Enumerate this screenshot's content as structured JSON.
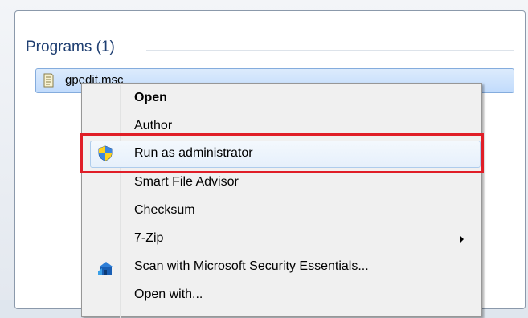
{
  "search_results": {
    "group_header": "Programs (1)",
    "program_label": "gpedit.msc",
    "program_icon": "script-document-icon"
  },
  "context_menu": {
    "items": [
      {
        "label": "Open",
        "bold": true
      },
      {
        "label": "Author"
      },
      {
        "label": "Run as administrator",
        "icon": "uac-shield-icon",
        "highlighted": true
      },
      {
        "label": "Smart File Advisor"
      },
      {
        "label": "Checksum"
      },
      {
        "label": "7-Zip",
        "has_submenu": true
      },
      {
        "label": "Scan with Microsoft Security Essentials...",
        "icon": "security-essentials-icon"
      },
      {
        "label": "Open with..."
      }
    ]
  },
  "annotation": {
    "highlight_color": "#e01e27",
    "highlighted_item": "Run as administrator"
  }
}
